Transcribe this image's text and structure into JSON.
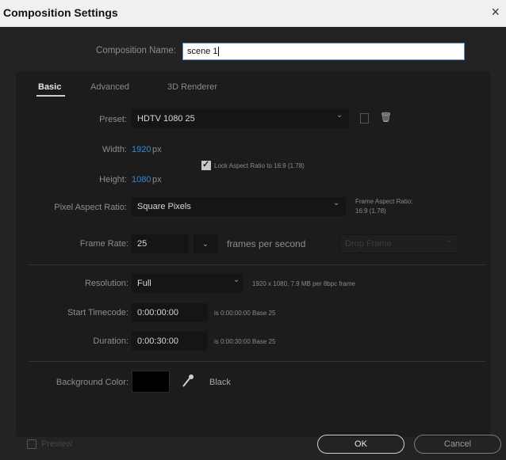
{
  "window": {
    "title": "Composition Settings",
    "close_glyph": "×"
  },
  "comp_name": {
    "label": "Composition Name:",
    "value": "scene 1"
  },
  "tabs": [
    {
      "label": "Basic",
      "active": true
    },
    {
      "label": "Advanced",
      "active": false
    },
    {
      "label": "3D Renderer",
      "active": false
    }
  ],
  "preset": {
    "label": "Preset:",
    "value": "HDTV 1080 25",
    "chevron": "⌄",
    "delete_icon": "🗑"
  },
  "width": {
    "label": "Width:",
    "value": "1920",
    "unit": "px"
  },
  "height": {
    "label": "Height:",
    "value": "1080",
    "unit": "px"
  },
  "lock_aspect": {
    "label": "Lock Aspect Ratio to 16:9 (1.78)",
    "checked": true,
    "check_glyph": "✓"
  },
  "pixel_aspect": {
    "label": "Pixel Aspect Ratio:",
    "value": "Square Pixels",
    "chevron": "⌄",
    "frame_aspect_label": "Frame Aspect Ratio:",
    "frame_aspect_value": "16:9 (1.78)"
  },
  "frame_rate": {
    "label": "Frame Rate:",
    "value": "25",
    "chevron": "⌄",
    "unit_label": "frames per second",
    "drop_frame": "Drop Frame",
    "drop_chevron": "⌄"
  },
  "resolution": {
    "label": "Resolution:",
    "value": "Full",
    "chevron": "⌄",
    "info": "1920 x 1080, 7.9 MB per 8bpc frame"
  },
  "start_timecode": {
    "label": "Start Timecode:",
    "value": "0:00:00:00",
    "info": "is 0:00:00:00  Base 25"
  },
  "duration": {
    "label": "Duration:",
    "value": "0:00:30:00",
    "info": "is 0:00:30:00  Base 25"
  },
  "background_color": {
    "label": "Background Color:",
    "swatch": "#000000",
    "name": "Black"
  },
  "footer": {
    "preview_label": "Preview",
    "ok_label": "OK",
    "cancel_label": "Cancel"
  },
  "colors": {
    "accent": "#3a86d6",
    "panel": "#1c1c1c",
    "dialog": "#232323"
  }
}
